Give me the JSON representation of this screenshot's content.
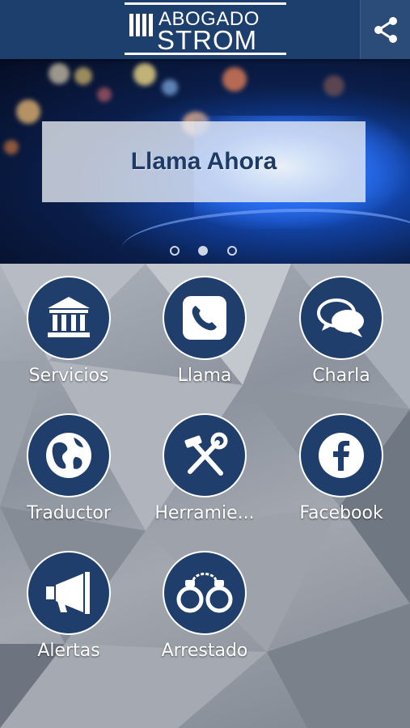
{
  "header": {
    "logo_line1": "ABOGADO",
    "logo_line2": "STROM",
    "share_icon": "share-icon",
    "bg_color": "#1d3f6e"
  },
  "banner": {
    "cta_label": "Llama Ahora",
    "slide_count": 3,
    "active_slide": 2
  },
  "grid": {
    "items": [
      {
        "label": "Servicios",
        "icon": "bank-icon"
      },
      {
        "label": "Llama",
        "icon": "phone-icon"
      },
      {
        "label": "Charla",
        "icon": "chat-icon"
      },
      {
        "label": "Traductor",
        "icon": "globe-icon"
      },
      {
        "label": "Herramie...",
        "icon": "tools-icon"
      },
      {
        "label": "Facebook",
        "icon": "facebook-icon"
      },
      {
        "label": "Alertas",
        "icon": "megaphone-icon"
      },
      {
        "label": "Arrestado",
        "icon": "handcuffs-icon"
      }
    ],
    "circle_color": "#1f3e6b"
  }
}
